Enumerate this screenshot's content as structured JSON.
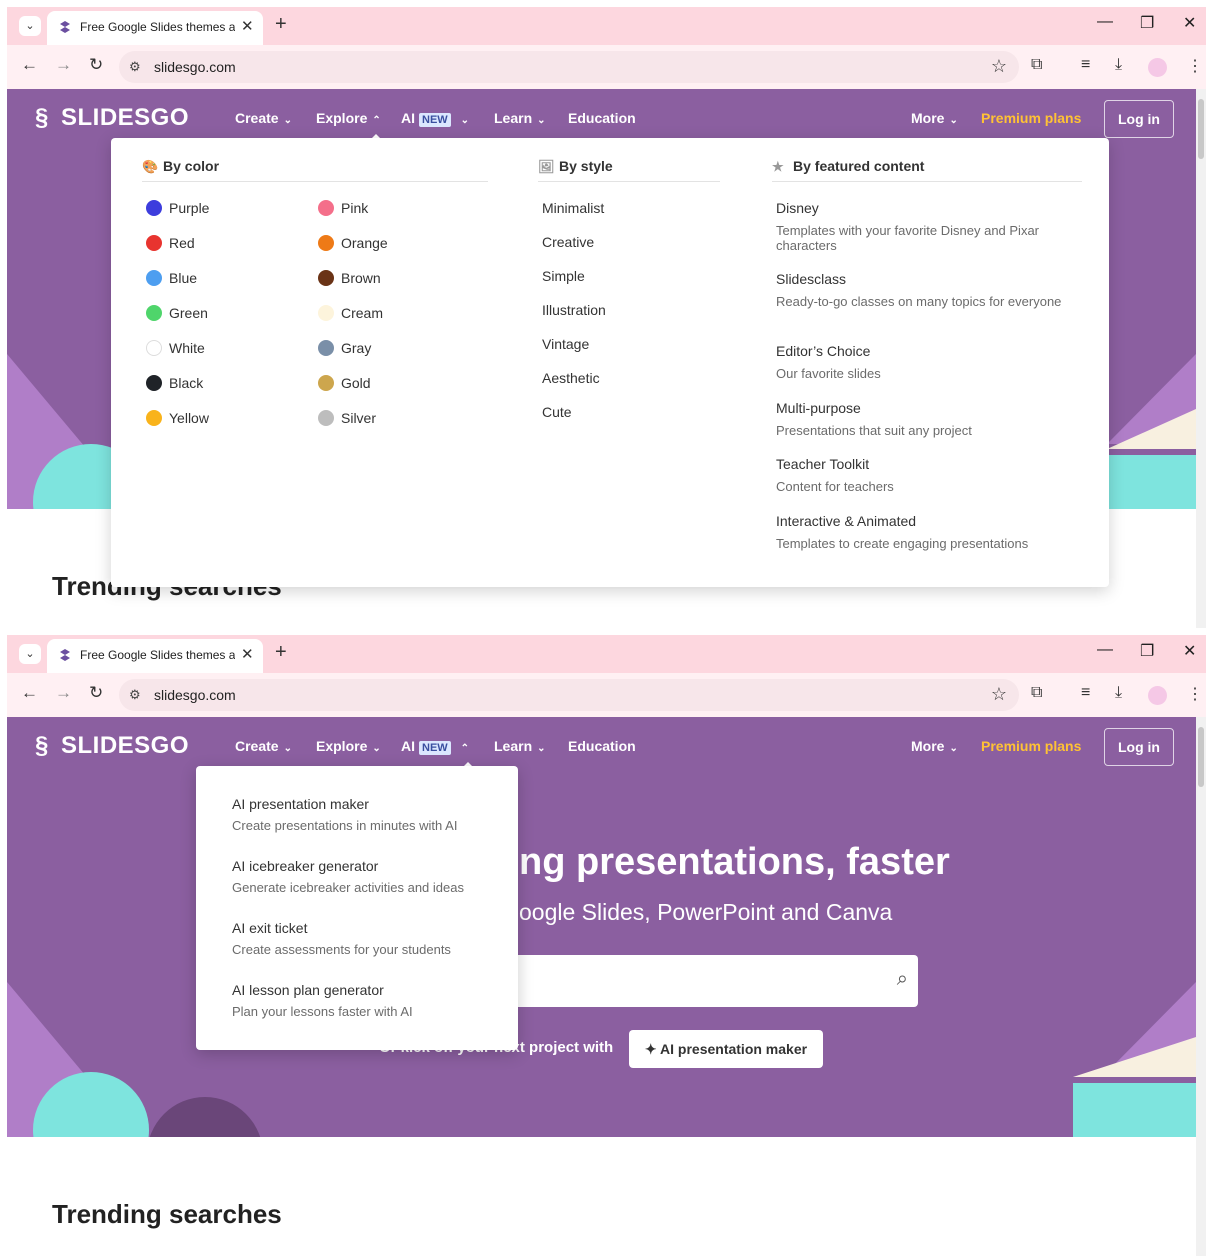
{
  "browser": {
    "tab_title": "Free Google Slides themes and",
    "url": "slidesgo.com"
  },
  "nav": {
    "logo": "SLIDESGO",
    "create": "Create",
    "explore": "Explore",
    "ai": "AI",
    "ai_badge": "NEW",
    "learn": "Learn",
    "education": "Education",
    "more": "More",
    "premium": "Premium plans",
    "login": "Log in"
  },
  "explore_menu": {
    "by_color": {
      "heading": "By color",
      "col1": [
        {
          "label": "Purple",
          "color": "#3d3ddd"
        },
        {
          "label": "Red",
          "color": "#e8342f"
        },
        {
          "label": "Blue",
          "color": "#4d9ef0"
        },
        {
          "label": "Green",
          "color": "#4fd56b"
        },
        {
          "label": "White",
          "color": "#ffffff"
        },
        {
          "label": "Black",
          "color": "#1f2328"
        },
        {
          "label": "Yellow",
          "color": "#f9b31b"
        }
      ],
      "col2": [
        {
          "label": "Pink",
          "color": "#f46f8a"
        },
        {
          "label": "Orange",
          "color": "#ee7a17"
        },
        {
          "label": "Brown",
          "color": "#6a3316"
        },
        {
          "label": "Cream",
          "color": "#fdf4dc"
        },
        {
          "label": "Gray",
          "color": "#7a8fa8"
        },
        {
          "label": "Gold",
          "color": "#cda64d"
        },
        {
          "label": "Silver",
          "color": "#bdbdbd"
        }
      ]
    },
    "by_style": {
      "heading": "By style",
      "items": [
        "Minimalist",
        "Creative",
        "Simple",
        "Illustration",
        "Vintage",
        "Aesthetic",
        "Cute"
      ]
    },
    "by_featured": {
      "heading": "By featured content",
      "items": [
        {
          "title": "Disney",
          "desc": "Templates with your favorite Disney and Pixar characters"
        },
        {
          "title": "Slidesclass",
          "desc": "Ready-to-go classes on many topics for everyone"
        },
        {
          "title": "Editor’s Choice",
          "desc": "Our favorite slides"
        },
        {
          "title": "Multi-purpose",
          "desc": "Presentations that suit any project"
        },
        {
          "title": "Teacher Toolkit",
          "desc": "Content for teachers"
        },
        {
          "title": "Interactive & Animated",
          "desc": "Templates to create engaging presentations"
        }
      ]
    }
  },
  "ai_menu": {
    "items": [
      {
        "title": "AI presentation maker",
        "desc": "Create presentations in minutes with AI"
      },
      {
        "title": "AI icebreaker generator",
        "desc": "Generate icebreaker activities and ideas"
      },
      {
        "title": "AI exit ticket",
        "desc": "Create assessments for your students"
      },
      {
        "title": "AI lesson plan generator",
        "desc": "Plan your lessons faster with AI"
      }
    ]
  },
  "hero": {
    "title_partial": "ng presentations, faster",
    "sub_partial": "oogle Slides, PowerPoint and Canva",
    "kick_partial": "Or kick off your next project with",
    "ai_button": "AI presentation maker"
  },
  "trending_partial": "Trending searches",
  "trending": "Trending searches",
  "colors": {
    "hero_bg": "#8b5fa0",
    "premium": "#ffc234",
    "tab_bar": "#fdd7df"
  }
}
